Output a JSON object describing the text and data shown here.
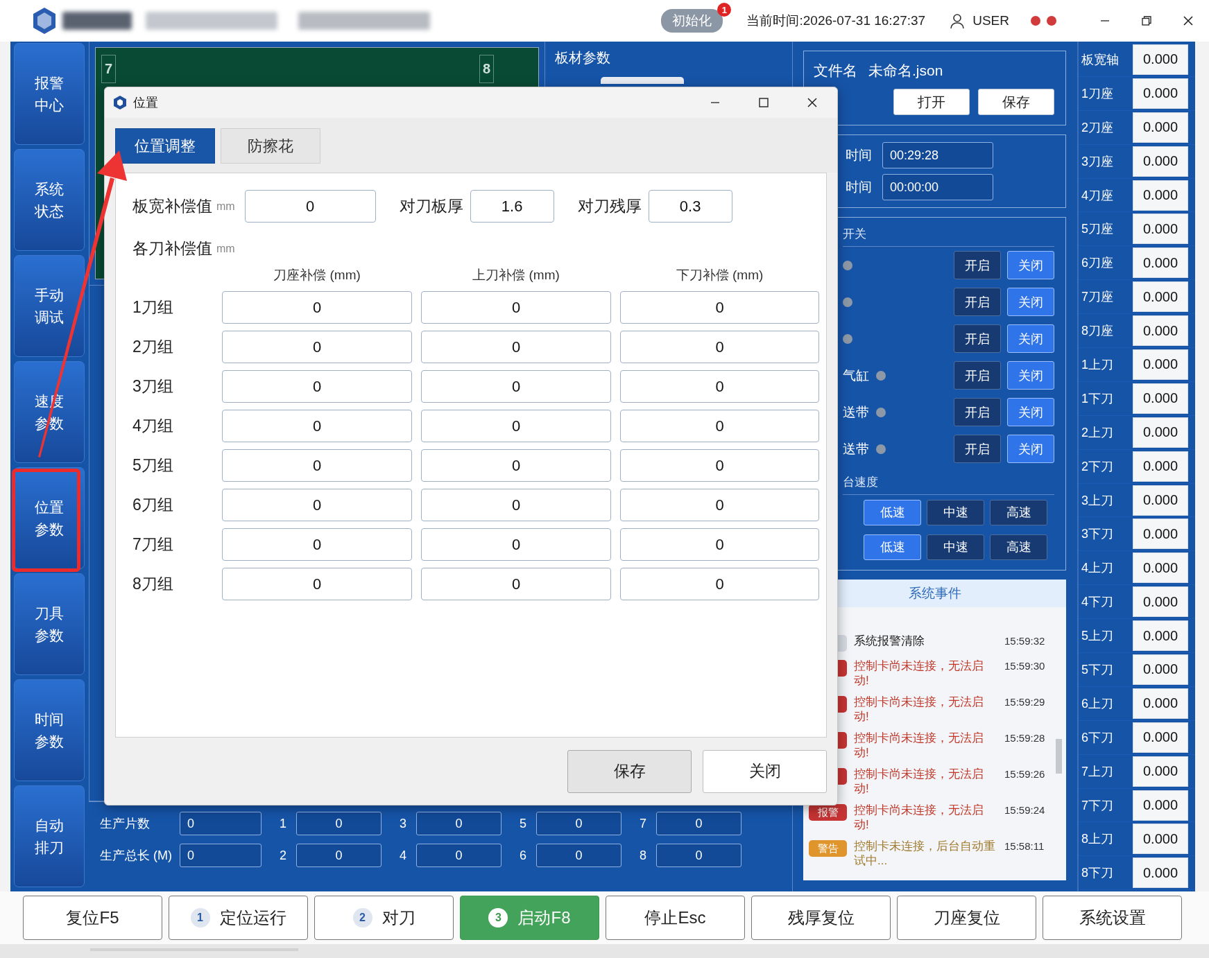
{
  "titlebar": {
    "status": {
      "label": "初始化",
      "badge": "1"
    },
    "clock": "当前时间:2026-07-31 16:27:37",
    "user": "USER",
    "indicators": [
      {
        "color": "#d23b3b"
      },
      {
        "color": "#d23b3b"
      }
    ]
  },
  "sidebar": {
    "items": [
      {
        "label": "报警中心",
        "highlighted": false
      },
      {
        "label": "系统状态",
        "highlighted": false
      },
      {
        "label": "手动调试",
        "highlighted": false
      },
      {
        "label": "速度参数",
        "highlighted": false
      },
      {
        "label": "位置参数",
        "highlighted": true
      },
      {
        "label": "刀具参数",
        "highlighted": false
      },
      {
        "label": "时间参数",
        "highlighted": false
      },
      {
        "label": "自动排刀",
        "highlighted": false
      }
    ]
  },
  "layout_canvas": {
    "markers": [
      "7",
      "8"
    ]
  },
  "sheet_params": {
    "title": "板材参数"
  },
  "production": {
    "rows": [
      {
        "label": "生产片数",
        "total": "0",
        "cells": [
          {
            "index": "1",
            "value": "0"
          },
          {
            "index": "3",
            "value": "0"
          },
          {
            "index": "5",
            "value": "0"
          },
          {
            "index": "7",
            "value": "0"
          }
        ]
      },
      {
        "label": "生产总长 (M)",
        "total": "0",
        "cells": [
          {
            "index": "2",
            "value": "0"
          },
          {
            "index": "4",
            "value": "0"
          },
          {
            "index": "6",
            "value": "0"
          },
          {
            "index": "8",
            "value": "0"
          }
        ]
      }
    ]
  },
  "file_panel": {
    "label": "文件名",
    "filename": "未命名.json",
    "buttons": [
      "打开",
      "保存"
    ]
  },
  "time_panel": {
    "rows": [
      {
        "label": "时间",
        "value": "00:29:28"
      },
      {
        "label": "时间",
        "value": "00:00:00"
      }
    ]
  },
  "switch_panel": {
    "title": "开关",
    "rows": [
      {
        "label": "",
        "on": false,
        "buttons": [
          "开启",
          "关闭"
        ]
      },
      {
        "label": "",
        "on": false,
        "buttons": [
          "开启",
          "关闭"
        ]
      },
      {
        "label": "",
        "on": false,
        "buttons": [
          "开启",
          "关闭"
        ]
      },
      {
        "label": "气缸",
        "on": false,
        "buttons": [
          "开启",
          "关闭"
        ]
      },
      {
        "label": "送带",
        "on": false,
        "buttons": [
          "开启",
          "关闭"
        ]
      },
      {
        "label": "送带",
        "on": false,
        "buttons": [
          "开启",
          "关闭"
        ]
      }
    ]
  },
  "speed_panel": {
    "title": "台速度",
    "rows": [
      {
        "options": [
          {
            "label": "低速",
            "selected": true
          },
          {
            "label": "中速",
            "selected": false
          },
          {
            "label": "高速",
            "selected": false
          }
        ]
      },
      {
        "options": [
          {
            "label": "低速",
            "selected": true
          },
          {
            "label": "中速",
            "selected": false
          },
          {
            "label": "高速",
            "selected": false
          }
        ]
      }
    ]
  },
  "events": {
    "title": "系统事件",
    "items": [
      {
        "kind": "info",
        "message": "系统报警清除",
        "time": "15:59:32"
      },
      {
        "kind": "alarm",
        "message": "控制卡尚未连接，无法启动!",
        "time": "15:59:30"
      },
      {
        "kind": "alarm",
        "message": "控制卡尚未连接，无法启动!",
        "time": "15:59:29"
      },
      {
        "kind": "alarm",
        "message": "控制卡尚未连接，无法启动!",
        "time": "15:59:28"
      },
      {
        "kind": "alarm",
        "message": "控制卡尚未连接，无法启动!",
        "time": "15:59:26"
      },
      {
        "kind": "alarm",
        "badge": "报警",
        "message": "控制卡尚未连接，无法启动!",
        "time": "15:59:24"
      },
      {
        "kind": "warning",
        "badge": "警告",
        "message": "控制卡未连接，后台自动重试中...",
        "time": "15:58:11"
      }
    ]
  },
  "axes": [
    {
      "label": "板宽轴",
      "value": "0.000"
    },
    {
      "label": "1刀座",
      "value": "0.000"
    },
    {
      "label": "2刀座",
      "value": "0.000"
    },
    {
      "label": "3刀座",
      "value": "0.000"
    },
    {
      "label": "4刀座",
      "value": "0.000"
    },
    {
      "label": "5刀座",
      "value": "0.000"
    },
    {
      "label": "6刀座",
      "value": "0.000"
    },
    {
      "label": "7刀座",
      "value": "0.000"
    },
    {
      "label": "8刀座",
      "value": "0.000"
    },
    {
      "label": "1上刀",
      "value": "0.000"
    },
    {
      "label": "1下刀",
      "value": "0.000"
    },
    {
      "label": "2上刀",
      "value": "0.000"
    },
    {
      "label": "2下刀",
      "value": "0.000"
    },
    {
      "label": "3上刀",
      "value": "0.000"
    },
    {
      "label": "3下刀",
      "value": "0.000"
    },
    {
      "label": "4上刀",
      "value": "0.000"
    },
    {
      "label": "4下刀",
      "value": "0.000"
    },
    {
      "label": "5上刀",
      "value": "0.000"
    },
    {
      "label": "5下刀",
      "value": "0.000"
    },
    {
      "label": "6上刀",
      "value": "0.000"
    },
    {
      "label": "6下刀",
      "value": "0.000"
    },
    {
      "label": "7上刀",
      "value": "0.000"
    },
    {
      "label": "7下刀",
      "value": "0.000"
    },
    {
      "label": "8上刀",
      "value": "0.000"
    },
    {
      "label": "8下刀",
      "value": "0.000"
    }
  ],
  "dialog": {
    "title": "位置",
    "tabs": [
      {
        "label": "位置调整",
        "selected": true
      },
      {
        "label": "防擦花",
        "selected": false
      }
    ],
    "top_fields": [
      {
        "label": "板宽补偿值",
        "unit": "mm",
        "value": "0"
      },
      {
        "label": "对刀板厚",
        "value": "1.6"
      },
      {
        "label": "对刀残厚",
        "value": "0.3"
      }
    ],
    "section": {
      "label": "各刀补偿值",
      "unit": "mm"
    },
    "columns": [
      "刀座补偿 (mm)",
      "上刀补偿 (mm)",
      "下刀补偿 (mm)"
    ],
    "rows": [
      {
        "label": "1刀组",
        "values": [
          "0",
          "0",
          "0"
        ]
      },
      {
        "label": "2刀组",
        "values": [
          "0",
          "0",
          "0"
        ]
      },
      {
        "label": "3刀组",
        "values": [
          "0",
          "0",
          "0"
        ]
      },
      {
        "label": "4刀组",
        "values": [
          "0",
          "0",
          "0"
        ]
      },
      {
        "label": "5刀组",
        "values": [
          "0",
          "0",
          "0"
        ]
      },
      {
        "label": "6刀组",
        "values": [
          "0",
          "0",
          "0"
        ]
      },
      {
        "label": "7刀组",
        "values": [
          "0",
          "0",
          "0"
        ]
      },
      {
        "label": "8刀组",
        "values": [
          "0",
          "0",
          "0"
        ]
      }
    ],
    "buttons": [
      {
        "label": "保存",
        "kind": "filled"
      },
      {
        "label": "关闭",
        "kind": "outline"
      }
    ]
  },
  "toolbar": {
    "buttons": [
      {
        "label": "复位F5",
        "active": false
      },
      {
        "label": "定位运行",
        "step": "1",
        "active": false
      },
      {
        "label": "对刀",
        "step": "2",
        "active": false
      },
      {
        "label": "启动F8",
        "step": "3",
        "active": true
      },
      {
        "label": "停止Esc",
        "active": false
      },
      {
        "label": "残厚复位",
        "active": false
      },
      {
        "label": "刀座复位",
        "active": false
      },
      {
        "label": "系统设置",
        "active": false
      }
    ]
  }
}
